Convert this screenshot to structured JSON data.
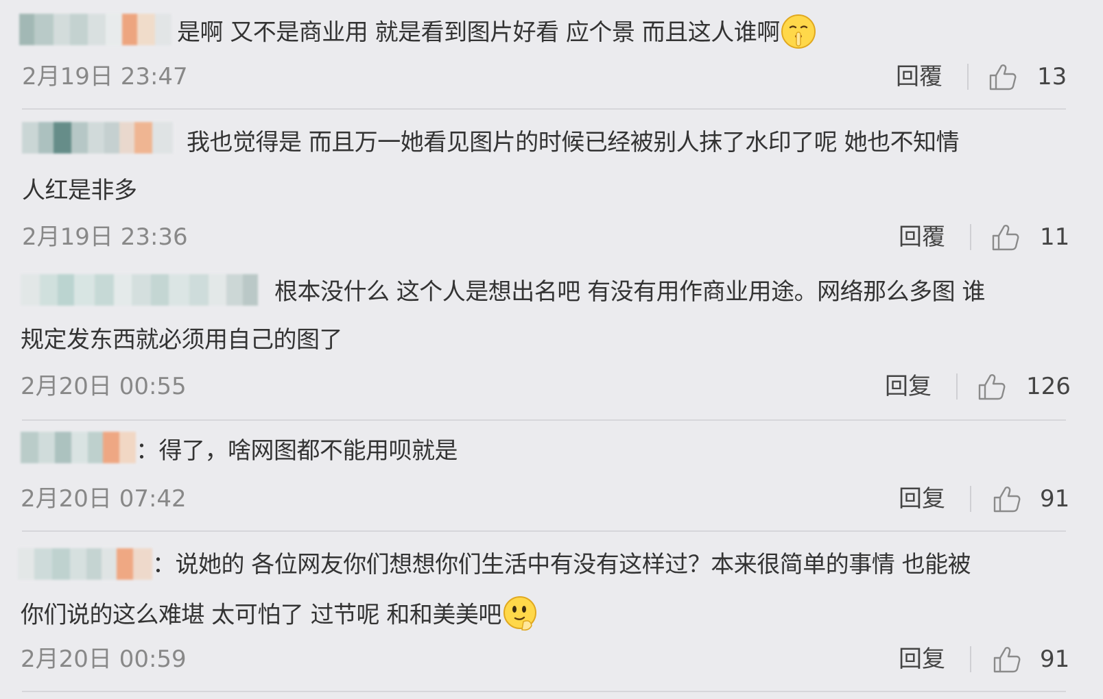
{
  "comments": [
    {
      "text_line1": "是啊 又不是商业用 就是看到图片好看 应个景 而且这人谁啊",
      "text_line2": "",
      "timestamp": "2月19日 23:47",
      "reply_label": "回覆",
      "likes": "13",
      "trailing_emoji": "shush-emoji"
    },
    {
      "text_line1": "我也觉得是 而且万一她看见图片的时候已经被别人抹了水印了呢 她也不知情",
      "text_line2": "人红是非多",
      "timestamp": "2月19日 23:36",
      "reply_label": "回覆",
      "likes": "11"
    },
    {
      "text_line1": "根本没什么 这个人是想出名吧 有没有用作商业用途。网络那么多图 谁",
      "text_line2": "规定发东西就必须用自己的图了",
      "timestamp": "2月20日 00:55",
      "reply_label": "回复",
      "likes": "126"
    },
    {
      "text_line1": "：得了，啥网图都不能用呗就是",
      "text_line2": "",
      "timestamp": "2月20日 07:42",
      "reply_label": "回复",
      "likes": "91"
    },
    {
      "text_line1": "：说她的 各位网友你们想想你们生活中有没有这样过？本来很简单的事情 也能被",
      "text_line2": "你们说的这么难堪 太可怕了 过节呢 和和美美吧",
      "timestamp": "2月20日 00:59",
      "reply_label": "回复",
      "likes": "91",
      "trailing_emoji": "thinking-emoji"
    }
  ],
  "icons": {
    "like": "thumbs-up-icon"
  },
  "colors": {
    "background": "#ebebee",
    "text": "#333333",
    "meta": "#888888",
    "divider": "#d6d6da"
  }
}
